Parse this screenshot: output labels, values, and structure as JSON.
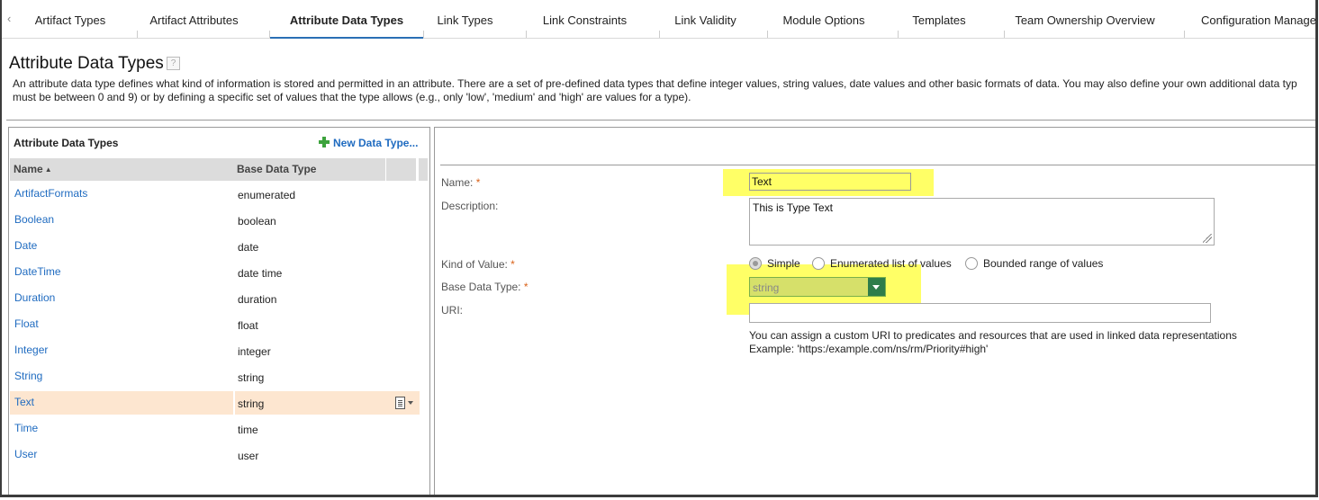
{
  "tabs": [
    {
      "label": "Artifact Types",
      "active": false
    },
    {
      "label": "Artifact Attributes",
      "active": false
    },
    {
      "label": "Attribute Data Types",
      "active": true
    },
    {
      "label": "Link Types",
      "active": false
    },
    {
      "label": "Link Constraints",
      "active": false
    },
    {
      "label": "Link Validity",
      "active": false
    },
    {
      "label": "Module Options",
      "active": false
    },
    {
      "label": "Templates",
      "active": false
    },
    {
      "label": "Team Ownership Overview",
      "active": false
    },
    {
      "label": "Configuration Managem",
      "active": false
    }
  ],
  "tab_scroll_icon": "chevron-left-icon",
  "page": {
    "title": "Attribute Data Types",
    "help_icon": "?",
    "description_line1": "An attribute data type defines what kind of information is stored and permitted in an attribute. There are a set of pre-defined data types that define integer values, string values, date values and other basic formats of data. You may also define your own additional data typ",
    "description_line2": "must be between 0 and 9) or by defining a specific set of values that the type allows (e.g., only 'low', 'medium' and 'high' are values for a type)."
  },
  "list": {
    "title": "Attribute Data Types",
    "new_button": "New Data Type...",
    "columns": {
      "name": "Name",
      "base": "Base Data Type"
    },
    "rows": [
      {
        "name": "ArtifactFormats",
        "base": "enumerated"
      },
      {
        "name": "Boolean",
        "base": "boolean"
      },
      {
        "name": "Date",
        "base": "date"
      },
      {
        "name": "DateTime",
        "base": "date time"
      },
      {
        "name": "Duration",
        "base": "duration"
      },
      {
        "name": "Float",
        "base": "float"
      },
      {
        "name": "Integer",
        "base": "integer"
      },
      {
        "name": "String",
        "base": "string"
      },
      {
        "name": "Text",
        "base": "string",
        "selected": true
      },
      {
        "name": "Time",
        "base": "time"
      },
      {
        "name": "User",
        "base": "user"
      }
    ]
  },
  "form": {
    "name_label": "Name:",
    "name_value": "Text",
    "description_label": "Description:",
    "description_value": "This is Type Text",
    "kind_label": "Kind of Value:",
    "kind_options": [
      "Simple",
      "Enumerated list of values",
      "Bounded range of values"
    ],
    "kind_selected": "Simple",
    "base_label": "Base Data Type:",
    "base_value": "string",
    "uri_label": "URI:",
    "uri_value": "",
    "hint_line1": "You can assign a custom URI to predicates and resources that are used in linked data representations",
    "hint_line2": "Example: 'https:/example.com/ns/rm/Priority#high'",
    "required_marker": "*"
  },
  "colors": {
    "accent": "#2a6fb5",
    "link": "#1f6bc0",
    "selected_row": "#fde6d0",
    "highlight": "#ffff66",
    "required": "#d9621a"
  }
}
